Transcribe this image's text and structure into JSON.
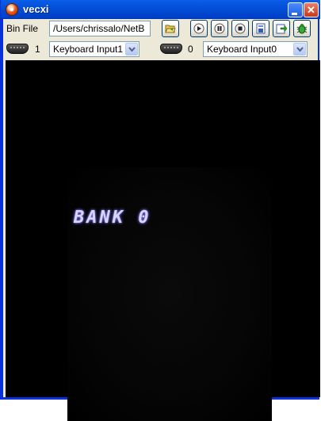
{
  "window": {
    "title": "vecxi"
  },
  "toolbar": {
    "bin_label": "Bin File",
    "bin_path": "/Users/chrissalo/NetB",
    "icons": [
      "folder-open-icon",
      "play-icon",
      "pause-icon",
      "stop-icon",
      "save-state-icon",
      "load-state-icon",
      "debug-bug-icon"
    ]
  },
  "controllers": {
    "joy1": {
      "number": "1",
      "input": "Keyboard Input1"
    },
    "joy0": {
      "number": "0",
      "input": "Keyboard Input0"
    }
  },
  "screen": {
    "text": "BANK 0",
    "color": "#d8d4ff"
  }
}
